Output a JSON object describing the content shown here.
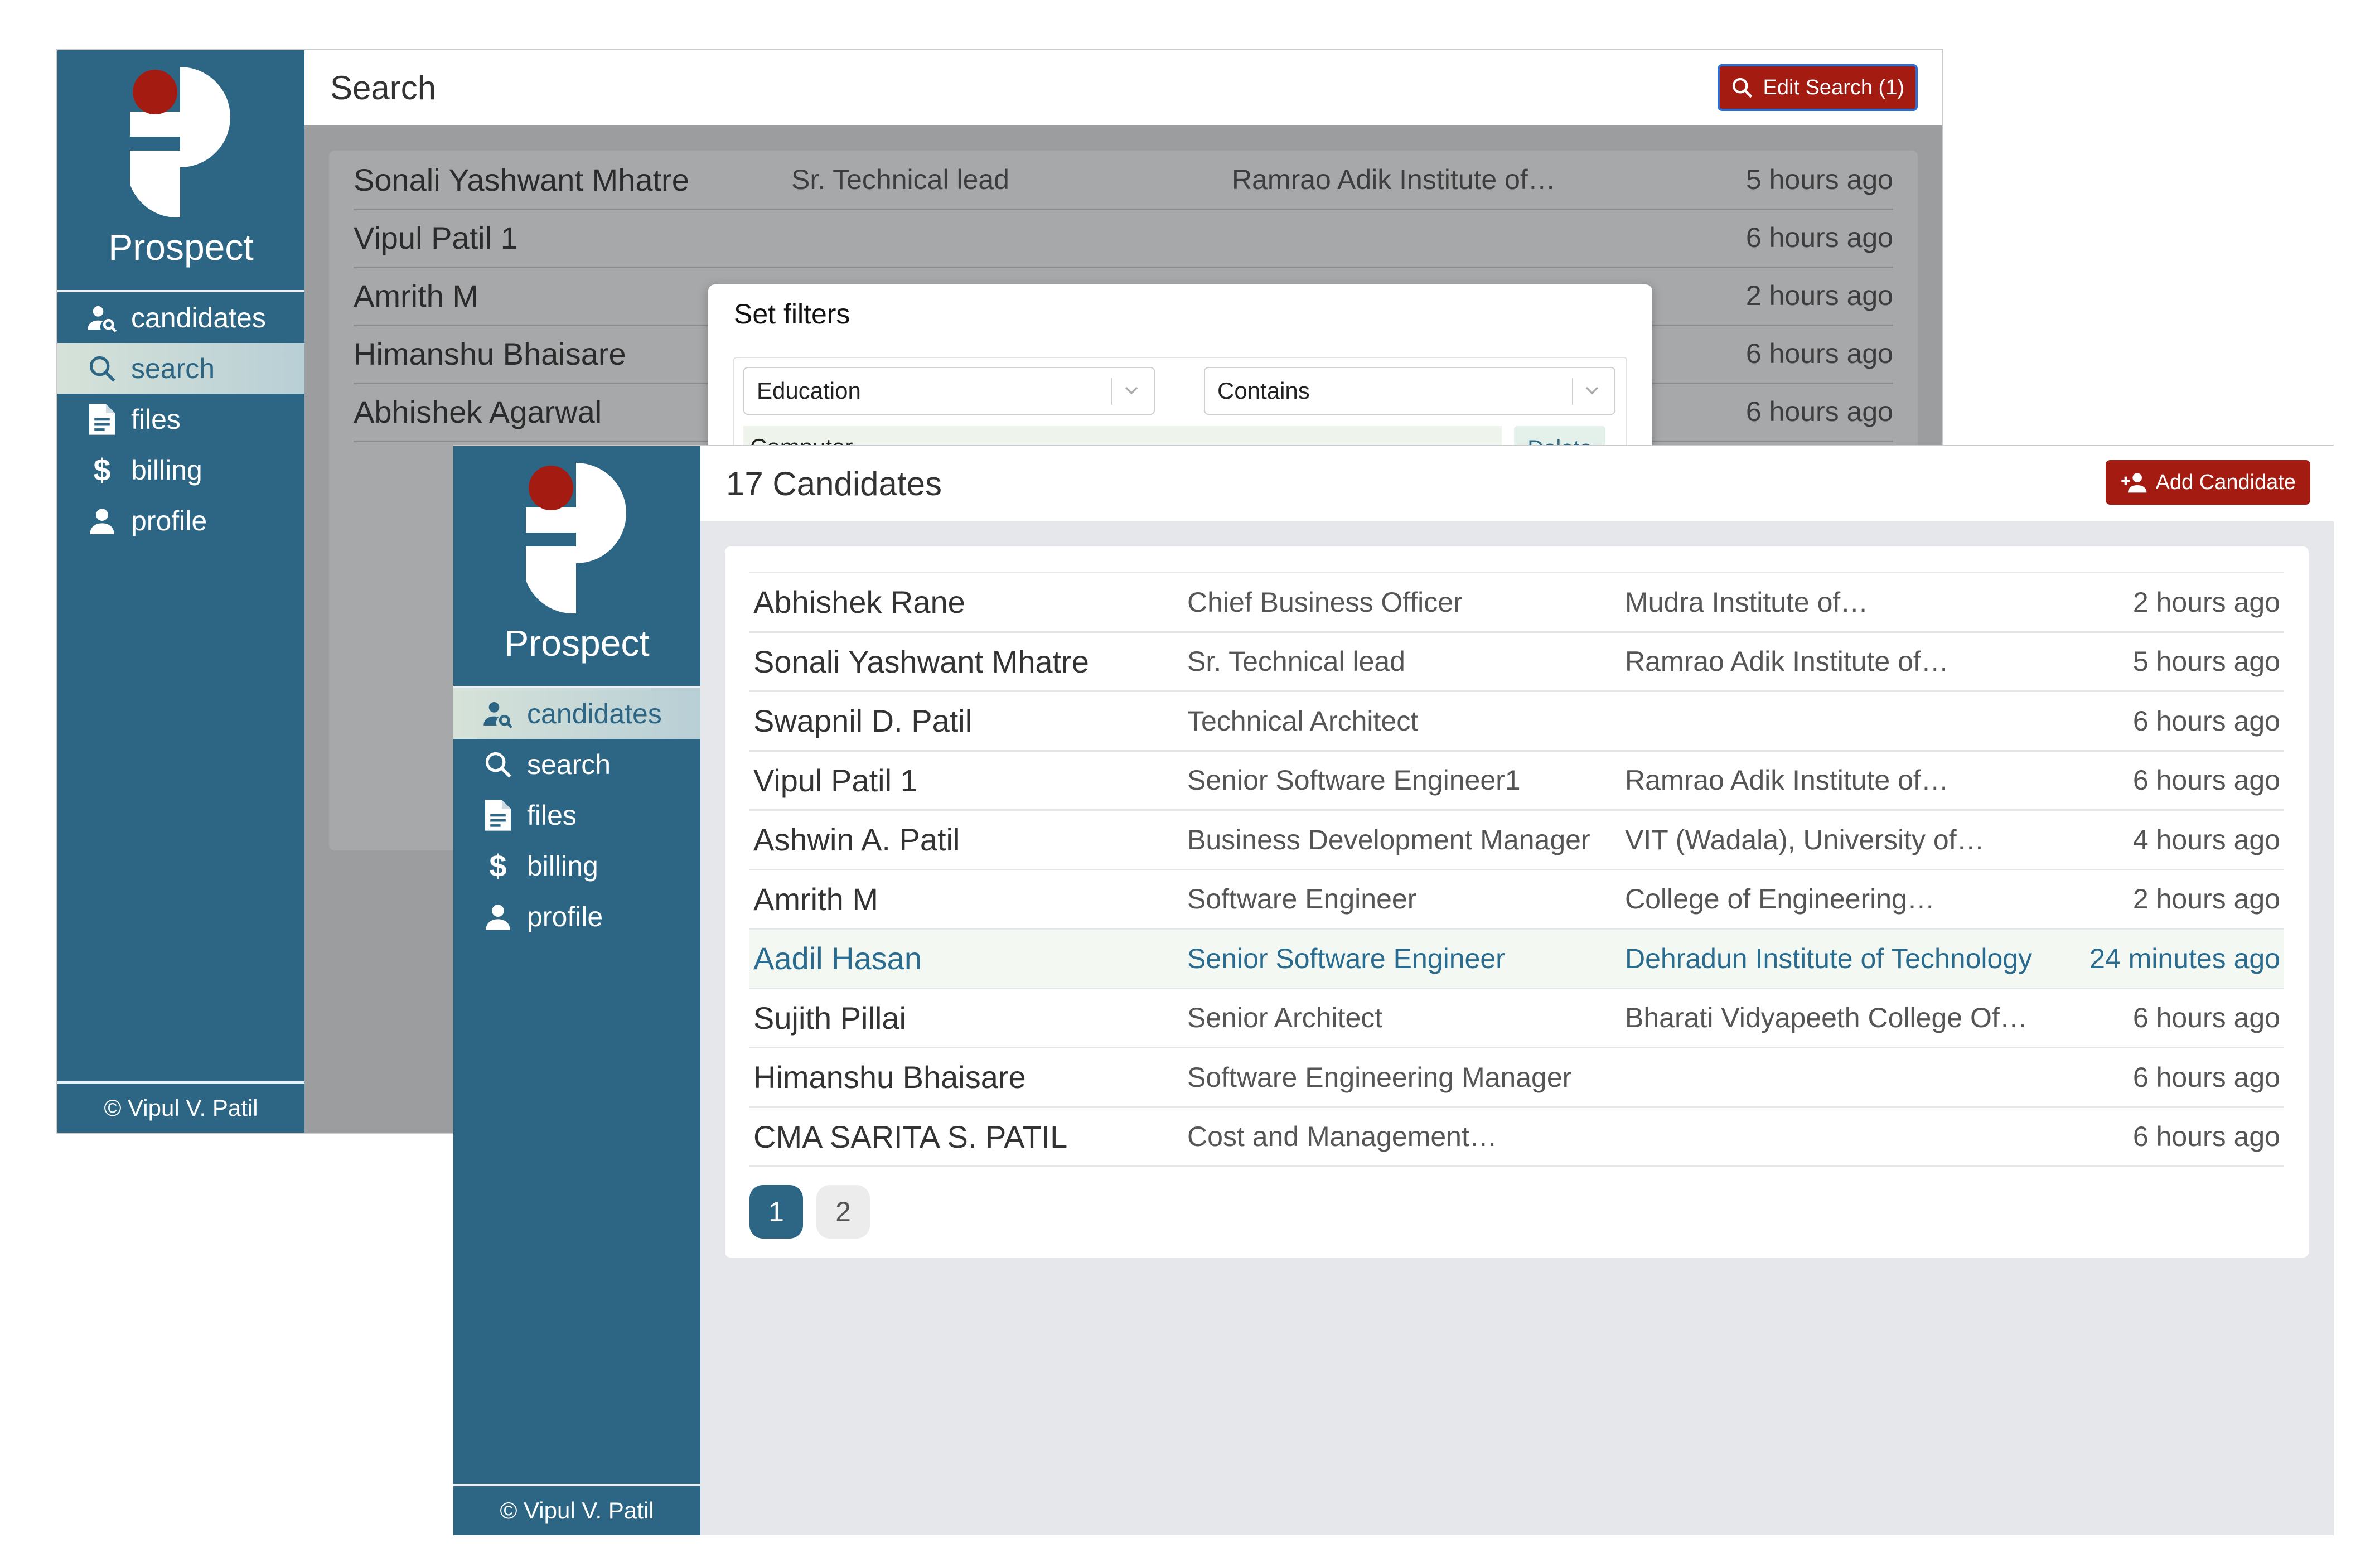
{
  "colors": {
    "sidebar": "#2c6684",
    "accent_red": "#a41b12",
    "logo_dot": "#a41b12",
    "highlight_text": "#2a6c8f",
    "active_nav_bg": "#d6e2d8"
  },
  "brand": {
    "name": "Prospect",
    "footer": "© Vipul V. Patil"
  },
  "nav": [
    {
      "label": "candidates",
      "icon": "user-search-icon"
    },
    {
      "label": "search",
      "icon": "search-icon"
    },
    {
      "label": "files",
      "icon": "file-icon"
    },
    {
      "label": "billing",
      "icon": "dollar-icon"
    },
    {
      "label": "profile",
      "icon": "person-icon"
    }
  ],
  "search_window": {
    "title": "Search",
    "edit_button": "Edit Search (1)",
    "active_nav": "search",
    "rows": [
      {
        "name": "Sonali Yashwant Mhatre",
        "title": "Sr. Technical lead",
        "school": "Ramrao Adik Institute of…",
        "time": "5 hours ago"
      },
      {
        "name": "Vipul Patil 1",
        "title": "",
        "school": "",
        "time": "6 hours ago"
      },
      {
        "name": "Amrith M",
        "title": "",
        "school": "",
        "time": "2 hours ago"
      },
      {
        "name": "Himanshu Bhaisare",
        "title": "",
        "school": "",
        "time": "6 hours ago"
      },
      {
        "name": "Abhishek Agarwal",
        "title": "",
        "school": "",
        "time": "6 hours ago"
      }
    ],
    "filter_modal": {
      "title": "Set filters",
      "field": "Education",
      "operator": "Contains",
      "value": "Computer",
      "delete_label": "Delete"
    }
  },
  "candidates_window": {
    "title": "17 Candidates",
    "add_button": "Add Candidate",
    "active_nav": "candidates",
    "rows": [
      {
        "name": "Abhishek Rane",
        "title": "Chief Business Officer",
        "school": "Mudra Institute of…",
        "time": "2 hours ago"
      },
      {
        "name": "Sonali Yashwant Mhatre",
        "title": "Sr. Technical lead",
        "school": "Ramrao Adik Institute of…",
        "time": "5 hours ago"
      },
      {
        "name": "Swapnil D. Patil",
        "title": "Technical Architect",
        "school": "",
        "time": "6 hours ago"
      },
      {
        "name": "Vipul Patil 1",
        "title": "Senior Software Engineer1",
        "school": "Ramrao Adik Institute of…",
        "time": "6 hours ago"
      },
      {
        "name": "Ashwin A. Patil",
        "title": "Business Development Manager",
        "school": "VIT (Wadala), University of…",
        "time": "4 hours ago"
      },
      {
        "name": "Amrith M",
        "title": "Software Engineer",
        "school": "College of Engineering…",
        "time": "2 hours ago"
      },
      {
        "name": "Aadil Hasan",
        "title": "Senior Software Engineer",
        "school": "Dehradun Institute of Technology",
        "time": "24 minutes ago"
      },
      {
        "name": "Sujith Pillai",
        "title": "Senior Architect",
        "school": "Bharati Vidyapeeth College Of…",
        "time": "6 hours ago"
      },
      {
        "name": "Himanshu Bhaisare",
        "title": "Software Engineering Manager",
        "school": "",
        "time": "6 hours ago"
      },
      {
        "name": "CMA SARITA S. PATIL",
        "title": "Cost and Management…",
        "school": "",
        "time": "6 hours ago"
      }
    ],
    "highlighted_row": 6,
    "pages": [
      "1",
      "2"
    ],
    "current_page": "1"
  }
}
